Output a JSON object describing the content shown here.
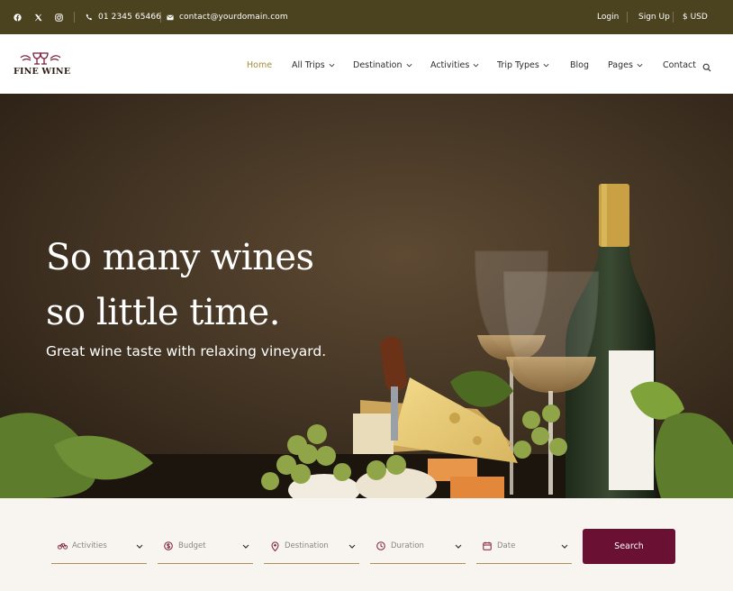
{
  "topbar": {
    "social_icons": [
      "facebook-icon",
      "x-twitter-icon",
      "instagram-icon"
    ],
    "phone": "01 2345 65466",
    "email": "contact@yourdomain.com",
    "login": "Login",
    "signup": "Sign Up",
    "currency": "$ USD"
  },
  "brand": {
    "name": "FINE WINE"
  },
  "nav": {
    "home": "Home",
    "all_trips": "All Trips",
    "destination": "Destination",
    "activities": "Activities",
    "trip_types": "Trip Types",
    "blog": "Blog",
    "pages": "Pages",
    "contact": "Contact"
  },
  "hero": {
    "title_line1": "So many wines",
    "title_line2": "so little time.",
    "subtitle": "Great wine taste with relaxing vineyard."
  },
  "search": {
    "activities": "Activities",
    "budget": "Budget",
    "destination": "Destination",
    "duration": "Duration",
    "date": "Date",
    "button": "Search"
  },
  "colors": {
    "topbar_bg": "#4b4220",
    "nav_active": "#a48b3c",
    "brand_accent": "#7a1d3a",
    "search_button": "#6a1032",
    "filter_underline": "#a9925a"
  }
}
